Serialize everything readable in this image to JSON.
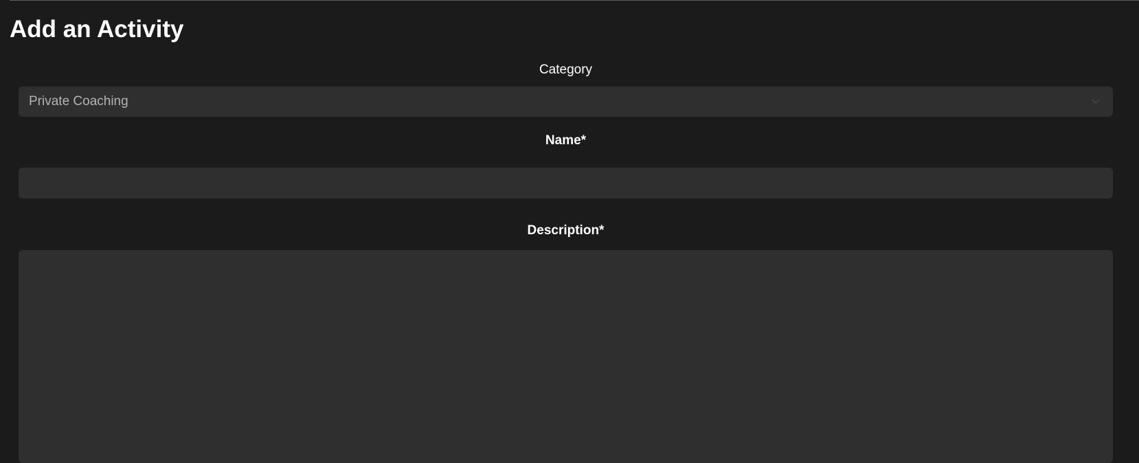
{
  "page": {
    "title": "Add an Activity"
  },
  "form": {
    "category": {
      "label": "Category",
      "selected_value": "Private Coaching",
      "icon": "chevron-down-icon"
    },
    "name": {
      "label": "Name*",
      "value": "",
      "placeholder": ""
    },
    "description": {
      "label": "Description*",
      "value": "",
      "placeholder": ""
    }
  },
  "colors": {
    "background": "#1b1b1b",
    "field_background": "#2f2f2f",
    "text": "#ffffff",
    "muted_text": "#b3b3b3"
  }
}
